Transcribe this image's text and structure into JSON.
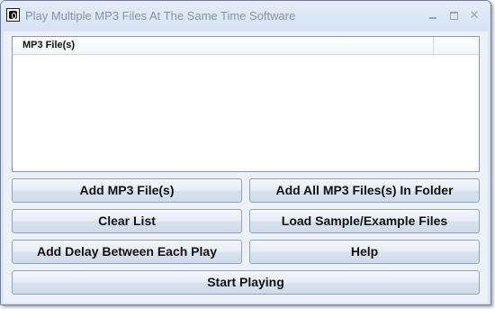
{
  "window": {
    "title": "Play Multiple MP3 Files At The Same Time Software",
    "controls": {
      "minimize": "",
      "maximize": "",
      "close": "✕"
    }
  },
  "listview": {
    "columns": [
      "MP3 File(s)"
    ],
    "rows": []
  },
  "buttons": {
    "add_files": "Add MP3 File(s)",
    "add_folder": "Add All MP3 Files(s) In Folder",
    "clear_list": "Clear List",
    "load_samples": "Load Sample/Example Files",
    "add_delay": "Add Delay Between Each Play",
    "help": "Help",
    "start": "Start Playing"
  }
}
